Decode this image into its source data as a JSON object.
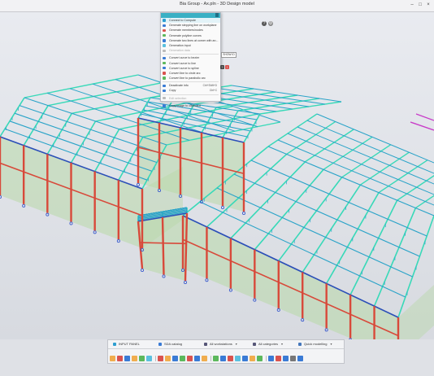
{
  "window": {
    "title": "Bia Group - Ax.pln - 3D Design model",
    "controls": [
      "–",
      "□",
      "×"
    ]
  },
  "context_menu": {
    "items": [
      {
        "label": "Connect to Compute",
        "icon": "connect-icon",
        "color": "#2d9ed0",
        "disabled": false
      },
      {
        "label": "Generate stepping line on workplane",
        "icon": "stepping-line-icon",
        "color": "#3a7bd5",
        "disabled": false
      },
      {
        "label": "Generate members/nodes",
        "icon": "members-icon",
        "color": "#d9534f",
        "disabled": false
      },
      {
        "label": "Generate polyline curves",
        "icon": "polyline-icon",
        "color": "#5cb85c",
        "disabled": false
      },
      {
        "label": "Generate two lines at corner with an...",
        "icon": "corner-lines-icon",
        "color": "#3a7bd5",
        "disabled": false
      },
      {
        "label": "Generation input",
        "icon": "generation-input-icon",
        "color": "#5bc0de",
        "disabled": false
      },
      {
        "label": "Generation data",
        "icon": "generation-data-icon",
        "color": "#bbbbbb",
        "disabled": true
      },
      {
        "label": "Convert curve to bezier",
        "icon": "bezier-icon",
        "color": "#3a7bd5",
        "disabled": false
      },
      {
        "label": "Convert curve to line",
        "icon": "curve-line-icon",
        "color": "#5cb85c",
        "disabled": false
      },
      {
        "label": "Convert curve to spline",
        "icon": "spline-icon",
        "color": "#3a7bd5",
        "disabled": false
      },
      {
        "label": "Convert line to circle arc",
        "icon": "circle-arc-icon",
        "color": "#d9534f",
        "disabled": false
      },
      {
        "label": "Convert line to parabolic arc",
        "icon": "parabolic-arc-icon",
        "color": "#5cb85c",
        "disabled": false
      },
      {
        "label": "Deactivate info",
        "icon": "info-icon",
        "color": "#3a7bd5",
        "disabled": false,
        "shortcut": "Ctrl+Shift+D"
      },
      {
        "label": "Copy",
        "icon": "copy-icon",
        "color": "#3a7bd5",
        "disabled": false,
        "shortcut": "Ctrl+C"
      },
      {
        "label": "Edit selection",
        "icon": "edit-icon",
        "color": "#bbbbbb",
        "disabled": true
      },
      {
        "label": "Copy image to clipboard",
        "icon": "image-icon",
        "color": "#3a7bd5",
        "disabled": false
      }
    ]
  },
  "tooltip": {
    "label": "SHOW ID"
  },
  "bottom_panel": {
    "tabs": [
      {
        "label": "INPUT PANEL",
        "color": "#2d9ed0"
      },
      {
        "label": "SDA catalog",
        "color": "#3a7bd5"
      },
      {
        "label": "All workstations",
        "color": "#555577"
      },
      {
        "label": "All categories",
        "color": "#555577"
      },
      {
        "label": "Quick modelling",
        "color": "#4477bb"
      }
    ],
    "toolbar_icons": [
      {
        "name": "pointer-icon",
        "color": "#f0ad4e"
      },
      {
        "name": "node-icon",
        "color": "#d9534f"
      },
      {
        "name": "member-icon",
        "color": "#3a7bd5"
      },
      {
        "name": "beam-icon",
        "color": "#f0ad4e"
      },
      {
        "name": "column-icon",
        "color": "#5cb85c"
      },
      {
        "name": "plate-icon",
        "color": "#5bc0de"
      },
      {
        "name": "support-icon",
        "color": "#d9534f"
      },
      {
        "name": "load-icon",
        "color": "#f0ad4e"
      },
      {
        "name": "section-icon",
        "color": "#3a7bd5"
      },
      {
        "name": "material-icon",
        "color": "#5cb85c"
      },
      {
        "name": "hinge-icon",
        "color": "#d9534f"
      },
      {
        "name": "mesh-icon",
        "color": "#3a7bd5"
      },
      {
        "name": "analysis-icon",
        "color": "#f0ad4e"
      },
      {
        "name": "result-icon",
        "color": "#5cb85c"
      },
      {
        "name": "report-icon",
        "color": "#3a7bd5"
      },
      {
        "name": "check-icon",
        "color": "#d9534f"
      },
      {
        "name": "grid-icon",
        "color": "#5bc0de"
      },
      {
        "name": "dimension-icon",
        "color": "#3a7bd5"
      },
      {
        "name": "text-icon",
        "color": "#f0ad4e"
      },
      {
        "name": "layer-icon",
        "color": "#5cb85c"
      },
      {
        "name": "view-icon",
        "color": "#3a7bd5"
      },
      {
        "name": "render-icon",
        "color": "#d9534f"
      },
      {
        "name": "export-icon",
        "color": "#3a7bd5"
      },
      {
        "name": "settings-icon",
        "color": "#777777"
      },
      {
        "name": "help-icon",
        "color": "#3a7bd5"
      }
    ]
  },
  "colors": {
    "column": "#d8493a",
    "truss": "#38d9b8",
    "purlin": "#2aa3c8",
    "beam_blue": "#2c4fb8",
    "wall_fill": "#b8d8a8",
    "accent": "#3ab0c4"
  }
}
